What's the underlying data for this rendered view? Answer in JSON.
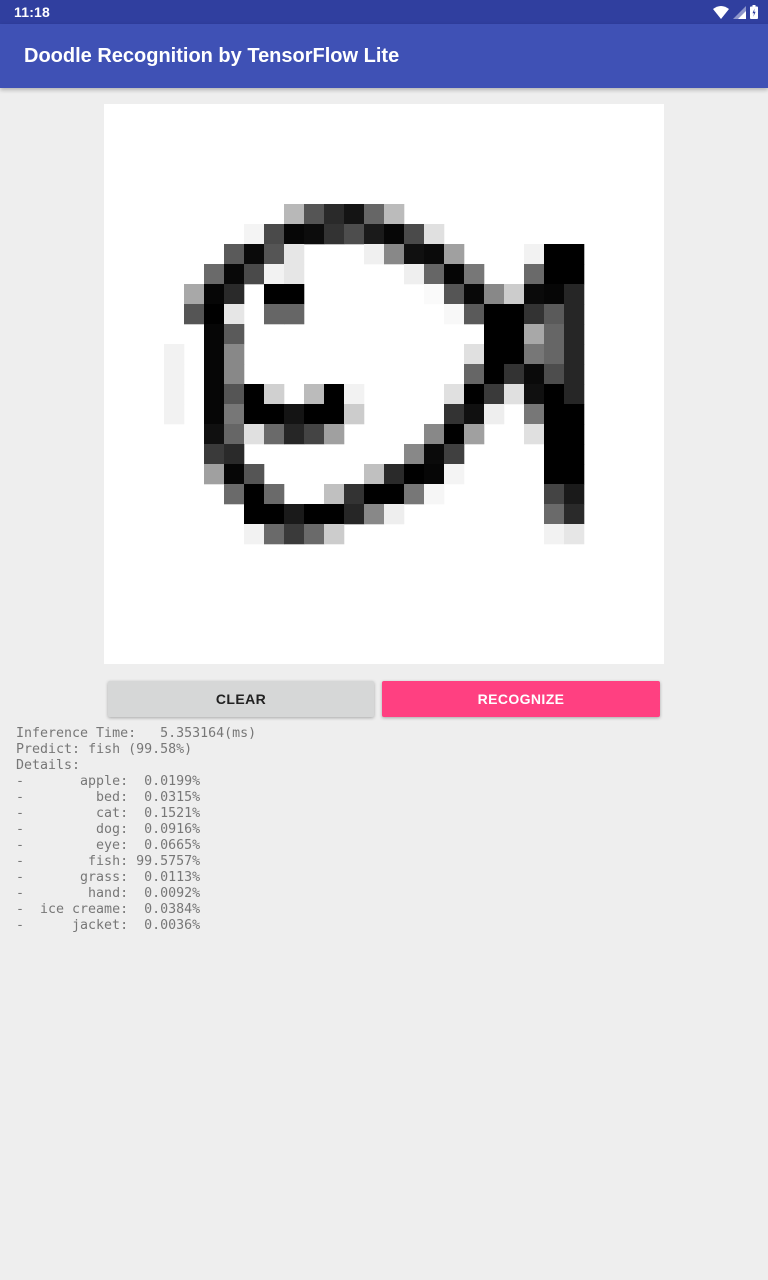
{
  "status_bar": {
    "time": "11:18",
    "icons": [
      "wifi-icon",
      "cell-signal-icon",
      "battery-icon"
    ]
  },
  "app_bar": {
    "title": "Doodle Recognition by TensorFlow Lite",
    "color": "#3f51b5"
  },
  "buttons": {
    "clear": "CLEAR",
    "recognize": "RECOGNIZE",
    "accent_color": "#ff4081"
  },
  "results": {
    "inference_label": "Inference Time:",
    "inference_value": "5.353164(ms)",
    "predict_label": "Predict:",
    "predict_value": "fish (99.58%)",
    "details_label": "Details:",
    "details": [
      {
        "label": "apple",
        "value": "0.0199%"
      },
      {
        "label": "bed",
        "value": "0.0315%"
      },
      {
        "label": "cat",
        "value": "0.1521%"
      },
      {
        "label": "dog",
        "value": "0.0916%"
      },
      {
        "label": "eye",
        "value": "0.0665%"
      },
      {
        "label": "fish",
        "value": "99.5757%"
      },
      {
        "label": "grass",
        "value": "0.0113%"
      },
      {
        "label": "hand",
        "value": "0.0092%"
      },
      {
        "label": "ice creame",
        "value": "0.0384%"
      },
      {
        "label": "jacket",
        "value": "0.0036%"
      }
    ]
  },
  "doodle": {
    "grid_size": 28,
    "pixels": [
      [
        9,
        5,
        "b8"
      ],
      [
        10,
        5,
        "55"
      ],
      [
        11,
        5,
        "2a"
      ],
      [
        12,
        5,
        "14"
      ],
      [
        13,
        5,
        "66"
      ],
      [
        14,
        5,
        "bb"
      ],
      [
        7,
        6,
        "f4"
      ],
      [
        8,
        6,
        "4a"
      ],
      [
        9,
        6,
        "06"
      ],
      [
        10,
        6,
        "0c"
      ],
      [
        11,
        6,
        "33"
      ],
      [
        12,
        6,
        "4d"
      ],
      [
        13,
        6,
        "1a"
      ],
      [
        14,
        6,
        "06"
      ],
      [
        15,
        6,
        "4a"
      ],
      [
        16,
        6,
        "e0"
      ],
      [
        6,
        7,
        "5a"
      ],
      [
        7,
        7,
        "0a"
      ],
      [
        8,
        7,
        "55"
      ],
      [
        9,
        7,
        "e6"
      ],
      [
        13,
        7,
        "f0"
      ],
      [
        14,
        7,
        "88"
      ],
      [
        15,
        7,
        "10"
      ],
      [
        16,
        7,
        "0a"
      ],
      [
        17,
        7,
        "a0"
      ],
      [
        21,
        7,
        "f2"
      ],
      [
        22,
        7,
        "00"
      ],
      [
        23,
        7,
        "00"
      ],
      [
        5,
        8,
        "6a"
      ],
      [
        6,
        8,
        "08"
      ],
      [
        7,
        8,
        "4a"
      ],
      [
        8,
        8,
        "f2"
      ],
      [
        9,
        8,
        "e6"
      ],
      [
        15,
        8,
        "ef"
      ],
      [
        16,
        8,
        "66"
      ],
      [
        17,
        8,
        "05"
      ],
      [
        18,
        8,
        "77"
      ],
      [
        21,
        8,
        "6a"
      ],
      [
        22,
        8,
        "00"
      ],
      [
        23,
        8,
        "00"
      ],
      [
        4,
        9,
        "a8"
      ],
      [
        5,
        9,
        "06"
      ],
      [
        6,
        9,
        "2a"
      ],
      [
        8,
        9,
        "00"
      ],
      [
        9,
        9,
        "00"
      ],
      [
        16,
        9,
        "fa"
      ],
      [
        17,
        9,
        "55"
      ],
      [
        18,
        9,
        "08"
      ],
      [
        19,
        9,
        "88"
      ],
      [
        20,
        9,
        "cc"
      ],
      [
        21,
        9,
        "0a"
      ],
      [
        22,
        9,
        "06"
      ],
      [
        23,
        9,
        "26"
      ],
      [
        4,
        10,
        "55"
      ],
      [
        5,
        10,
        "00"
      ],
      [
        6,
        10,
        "e6"
      ],
      [
        8,
        10,
        "66"
      ],
      [
        9,
        10,
        "66"
      ],
      [
        17,
        10,
        "f8"
      ],
      [
        18,
        10,
        "5a"
      ],
      [
        19,
        10,
        "00"
      ],
      [
        20,
        10,
        "00"
      ],
      [
        21,
        10,
        "33"
      ],
      [
        22,
        10,
        "5a"
      ],
      [
        23,
        10,
        "26"
      ],
      [
        5,
        11,
        "06"
      ],
      [
        6,
        11,
        "5a"
      ],
      [
        19,
        11,
        "00"
      ],
      [
        20,
        11,
        "00"
      ],
      [
        21,
        11,
        "a8"
      ],
      [
        22,
        11,
        "66"
      ],
      [
        23,
        11,
        "26"
      ],
      [
        3,
        12,
        "f2"
      ],
      [
        5,
        12,
        "06"
      ],
      [
        6,
        12,
        "88"
      ],
      [
        18,
        12,
        "e0"
      ],
      [
        19,
        12,
        "00"
      ],
      [
        20,
        12,
        "00"
      ],
      [
        21,
        12,
        "77"
      ],
      [
        22,
        12,
        "66"
      ],
      [
        23,
        12,
        "26"
      ],
      [
        3,
        13,
        "f2"
      ],
      [
        5,
        13,
        "06"
      ],
      [
        6,
        13,
        "88"
      ],
      [
        18,
        13,
        "66"
      ],
      [
        19,
        13,
        "00"
      ],
      [
        20,
        13,
        "33"
      ],
      [
        21,
        13,
        "0a"
      ],
      [
        22,
        13,
        "4d"
      ],
      [
        23,
        13,
        "26"
      ],
      [
        3,
        14,
        "f2"
      ],
      [
        5,
        14,
        "06"
      ],
      [
        6,
        14,
        "55"
      ],
      [
        7,
        14,
        "00"
      ],
      [
        8,
        14,
        "d0"
      ],
      [
        10,
        14,
        "bb"
      ],
      [
        11,
        14,
        "00"
      ],
      [
        12,
        14,
        "f2"
      ],
      [
        17,
        14,
        "e0"
      ],
      [
        18,
        14,
        "00"
      ],
      [
        19,
        14,
        "3a"
      ],
      [
        20,
        14,
        "e0"
      ],
      [
        21,
        14,
        "10"
      ],
      [
        22,
        14,
        "00"
      ],
      [
        23,
        14,
        "26"
      ],
      [
        3,
        15,
        "f2"
      ],
      [
        5,
        15,
        "06"
      ],
      [
        6,
        15,
        "77"
      ],
      [
        7,
        15,
        "00"
      ],
      [
        8,
        15,
        "00"
      ],
      [
        9,
        15,
        "14"
      ],
      [
        10,
        15,
        "00"
      ],
      [
        11,
        15,
        "00"
      ],
      [
        12,
        15,
        "cc"
      ],
      [
        17,
        15,
        "33"
      ],
      [
        18,
        15,
        "10"
      ],
      [
        19,
        15,
        "ee"
      ],
      [
        21,
        15,
        "77"
      ],
      [
        22,
        15,
        "00"
      ],
      [
        23,
        15,
        "00"
      ],
      [
        5,
        16,
        "10"
      ],
      [
        6,
        16,
        "66"
      ],
      [
        7,
        16,
        "e0"
      ],
      [
        8,
        16,
        "6a"
      ],
      [
        9,
        16,
        "26"
      ],
      [
        10,
        16,
        "44"
      ],
      [
        11,
        16,
        "a0"
      ],
      [
        16,
        16,
        "88"
      ],
      [
        17,
        16,
        "00"
      ],
      [
        18,
        16,
        "a0"
      ],
      [
        21,
        16,
        "e0"
      ],
      [
        22,
        16,
        "00"
      ],
      [
        23,
        16,
        "00"
      ],
      [
        5,
        17,
        "3a"
      ],
      [
        6,
        17,
        "2a"
      ],
      [
        15,
        17,
        "88"
      ],
      [
        16,
        17,
        "0a"
      ],
      [
        17,
        17,
        "40"
      ],
      [
        22,
        17,
        "00"
      ],
      [
        23,
        17,
        "00"
      ],
      [
        5,
        18,
        "a0"
      ],
      [
        6,
        18,
        "06"
      ],
      [
        7,
        18,
        "55"
      ],
      [
        13,
        18,
        "c0"
      ],
      [
        14,
        18,
        "2a"
      ],
      [
        15,
        18,
        "00"
      ],
      [
        16,
        18,
        "06"
      ],
      [
        17,
        18,
        "f4"
      ],
      [
        22,
        18,
        "00"
      ],
      [
        23,
        18,
        "00"
      ],
      [
        6,
        19,
        "6a"
      ],
      [
        7,
        19,
        "00"
      ],
      [
        8,
        19,
        "6a"
      ],
      [
        11,
        19,
        "c0"
      ],
      [
        12,
        19,
        "33"
      ],
      [
        13,
        19,
        "00"
      ],
      [
        14,
        19,
        "00"
      ],
      [
        15,
        19,
        "77"
      ],
      [
        16,
        19,
        "f6"
      ],
      [
        22,
        19,
        "44"
      ],
      [
        23,
        19,
        "1a"
      ],
      [
        7,
        20,
        "00"
      ],
      [
        8,
        20,
        "00"
      ],
      [
        9,
        20,
        "1a"
      ],
      [
        10,
        20,
        "00"
      ],
      [
        11,
        20,
        "00"
      ],
      [
        12,
        20,
        "26"
      ],
      [
        13,
        20,
        "88"
      ],
      [
        14,
        20,
        "ee"
      ],
      [
        22,
        20,
        "6a"
      ],
      [
        23,
        20,
        "2a"
      ],
      [
        7,
        21,
        "f2"
      ],
      [
        8,
        21,
        "6a"
      ],
      [
        9,
        21,
        "3a"
      ],
      [
        10,
        21,
        "6a"
      ],
      [
        11,
        21,
        "cc"
      ],
      [
        22,
        21,
        "f2"
      ],
      [
        23,
        21,
        "e6"
      ]
    ]
  }
}
